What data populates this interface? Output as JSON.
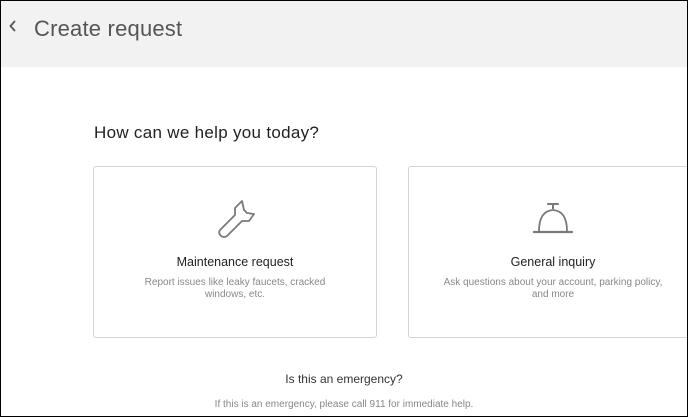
{
  "header": {
    "title": "Create request",
    "back_icon": "chevron-left-icon"
  },
  "main": {
    "heading": "How can we help you today?",
    "cards": [
      {
        "icon": "wrench-icon",
        "title": "Maintenance request",
        "description": "Report issues like leaky faucets, cracked windows, etc."
      },
      {
        "icon": "service-bell-icon",
        "title": "General inquiry",
        "description": "Ask questions about your account, parking policy, and more"
      }
    ]
  },
  "emergency": {
    "question": "Is this an emergency?",
    "text": "If this is an emergency, please call 911 for immediate help."
  },
  "colors": {
    "header_bg": "#f2f2f2",
    "icon": "#7a7a7a",
    "card_border": "#d4d4d4"
  }
}
